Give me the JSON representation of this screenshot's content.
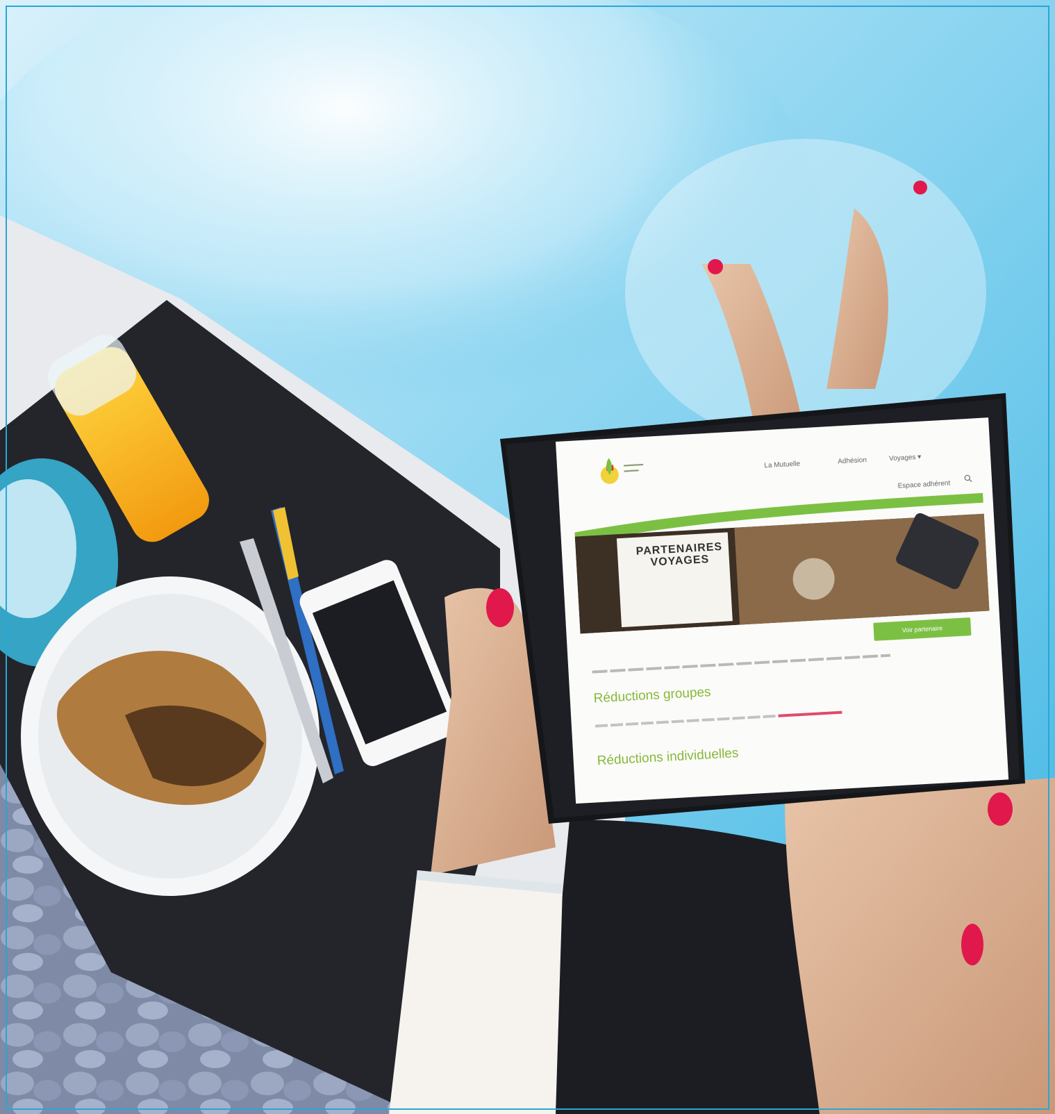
{
  "scene": {
    "description_colors": {
      "pool_water": "#5fc4e8",
      "table_dark": "#2b2d33",
      "orange_juice": "#f6b21a",
      "nail_polish": "#e0184c",
      "site_green": "#7cc043"
    }
  },
  "website": {
    "nav": [
      "La Mutuelle",
      "Adhésion",
      "Voyages ▾"
    ],
    "nav_secondary": "Espace adhérent",
    "hero_title": "PARTENAIRES VOYAGES",
    "button_label": "Voir partenaire",
    "section1": "Réductions groupes",
    "section2": "Réductions individuelles"
  },
  "icons": {
    "search": "search-icon",
    "logo": "logo-icon"
  }
}
